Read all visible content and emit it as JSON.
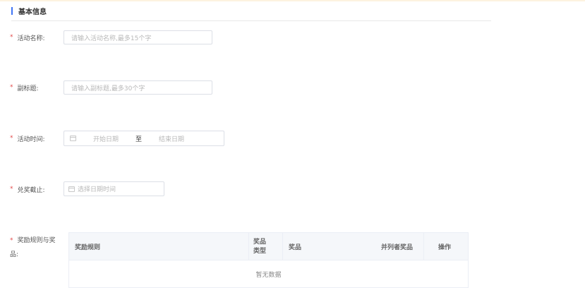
{
  "section": {
    "title": "基本信息"
  },
  "required_mark": "*",
  "fields": {
    "name": {
      "label": "活动名称:",
      "placeholder": "请输入活动名称,最多15个字"
    },
    "subtitle": {
      "label": "副标题:",
      "placeholder": "请输入副标题,最多30个字"
    },
    "time": {
      "label": "活动时间:",
      "start_placeholder": "开始日期",
      "separator": "至",
      "end_placeholder": "结束日期"
    },
    "deadline": {
      "label": "兑奖截止:",
      "placeholder": "选择日期时间"
    }
  },
  "prize_rules": {
    "label": "奖励规则与奖品:",
    "columns": [
      "奖励规则",
      "奖品类型",
      "奖品",
      "并列者奖品",
      "操作"
    ],
    "empty_text": "暂无数据"
  },
  "colors": {
    "accent": "#3f74f5",
    "required": "#e24c4c",
    "border": "#dcdfe6"
  },
  "icons": {
    "date": "calendar-icon"
  }
}
